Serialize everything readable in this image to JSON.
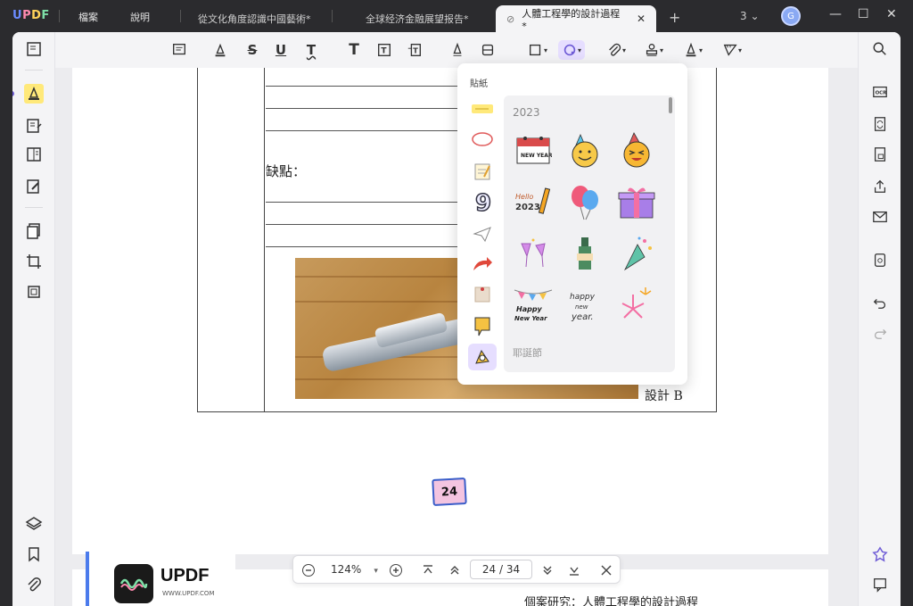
{
  "titlebar": {
    "logo": "UPDF",
    "menu": [
      "檔案",
      "說明"
    ],
    "tabs": [
      {
        "label": "從文化角度認識中國藝術*"
      },
      {
        "label": "全球经济金融展望报告*"
      },
      {
        "label": "人體工程學的設計過程*"
      }
    ],
    "tab_count": "3",
    "avatar_initial": "G"
  },
  "document": {
    "shortcomings_label": "缺點：",
    "design_label": "設計 B",
    "page_badge": "24",
    "footer_text": "個案研究：人體工程學的設計過程"
  },
  "sticker_popover": {
    "title": "貼紙",
    "year_section": "2023",
    "holiday_section": "耶誕節",
    "stickers": [
      {
        "name": "new-year-calendar",
        "label": "NEW YEAR"
      },
      {
        "name": "party-smiley"
      },
      {
        "name": "party-face"
      },
      {
        "name": "hello-2023-pencil",
        "label": "HELLO 2023"
      },
      {
        "name": "balloons"
      },
      {
        "name": "gift-box"
      },
      {
        "name": "champagne-glasses"
      },
      {
        "name": "champagne-bottle"
      },
      {
        "name": "party-popper"
      },
      {
        "name": "happy-new-year-bunting",
        "label": "Happy New Year"
      },
      {
        "name": "happy-new-year-script",
        "label": "happy new year."
      },
      {
        "name": "fireworks"
      }
    ]
  },
  "bottom_nav": {
    "zoom": "124%",
    "current_page": "24",
    "total_pages": "34",
    "page_display": "24 / 34"
  },
  "watermark": {
    "brand": "UPDF",
    "url": "WWW.UPDF.COM"
  },
  "colors": {
    "accent": "#6e5bd6",
    "active_tool_bg": "#e6deff",
    "highlight": "#ffe97a"
  }
}
